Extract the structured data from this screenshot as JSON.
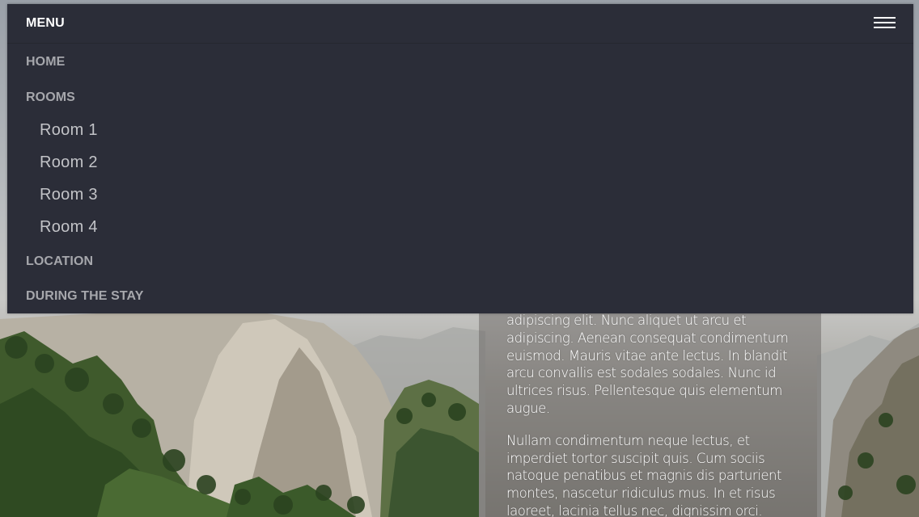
{
  "menu": {
    "title": "MENU",
    "toggle_icon": "hamburger-menu-icon",
    "items": [
      {
        "label": "HOME"
      },
      {
        "label": "ROOMS",
        "children": [
          {
            "label": "Room 1"
          },
          {
            "label": "Room 2"
          },
          {
            "label": "Room 3"
          },
          {
            "label": "Room 4"
          }
        ]
      },
      {
        "label": "LOCATION"
      },
      {
        "label": "DURING THE STAY"
      }
    ]
  },
  "content": {
    "paragraphs": [
      "adipiscing elit. Nunc aliquet ut arcu et adipiscing. Aenean consequat condimentum euismod. Mauris vitae ante lectus. In blandit arcu convallis est sodales sodales. Nunc id ultrices risus. Pellentesque quis elementum augue.",
      "Nullam condimentum neque lectus, et imperdiet tortor suscipit quis. Cum sociis natoque penatibus et magnis dis parturient montes, nascetur ridiculus mus. In et risus laoreet, lacinia tellus nec, dignissim orci."
    ]
  },
  "colors": {
    "nav_background": "#2b2d38",
    "nav_item_text": "#a6a7ac",
    "sub_item_text": "#c2c3c7",
    "title_text": "#ffffff"
  }
}
